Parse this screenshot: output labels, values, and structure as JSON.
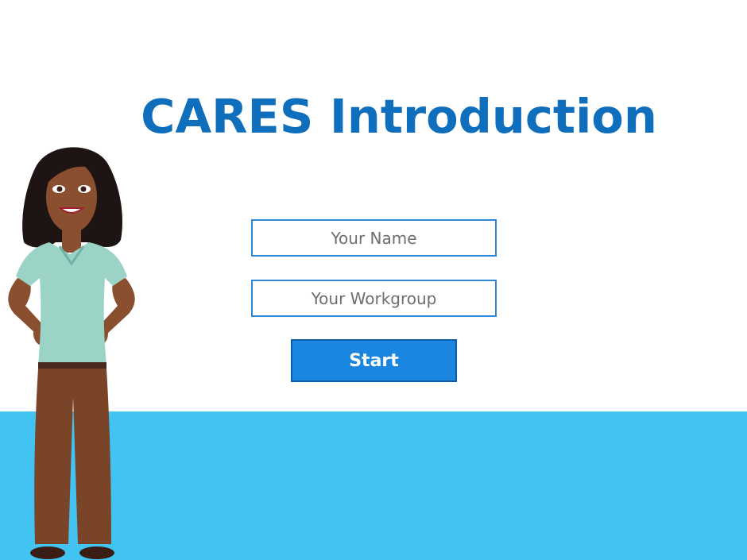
{
  "page": {
    "title": "CARES Introduction"
  },
  "form": {
    "name_placeholder": "Your Name",
    "workgroup_placeholder": "Your Workgroup",
    "start_label": "Start"
  },
  "colors": {
    "title": "#0f6fbd",
    "button": "#1a86e0",
    "floor": "#42c3f2",
    "input_border": "#2e86d6"
  }
}
